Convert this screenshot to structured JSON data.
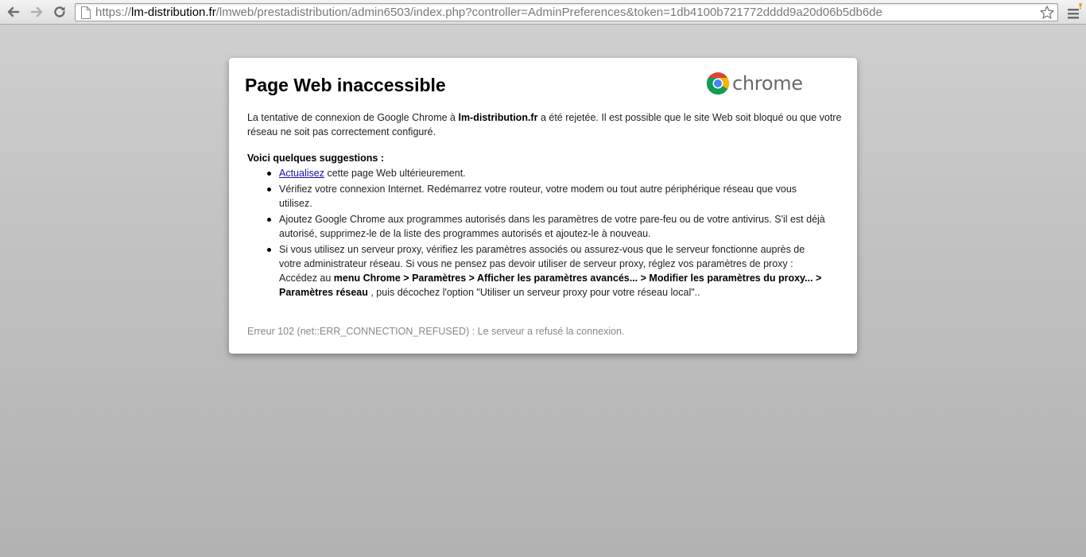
{
  "toolbar": {
    "url_scheme": "https://",
    "url_host": "lm-distribution.fr",
    "url_rest": "/lmweb/prestadistribution/admin6503/index.php?controller=AdminPreferences&token=1db4100b721772dddd9a20d06b5db6de",
    "icons": {
      "back": "back-arrow-icon",
      "forward": "forward-arrow-icon",
      "reload": "reload-icon",
      "page": "page-icon",
      "star": "star-icon",
      "menu": "menu-icon"
    }
  },
  "error": {
    "logo_text": "chrome",
    "title": "Page Web inaccessible",
    "intro_part1": "La tentative de connexion de Google Chrome à ",
    "intro_host": "lm-distribution.fr",
    "intro_part2": " a été rejetée. Il est possible que le site Web soit bloqué ou que votre réseau ne soit pas correctement configuré.",
    "suggestions_title": "Voici quelques suggestions :",
    "suggestions": [
      {
        "link": "Actualisez",
        "text": " cette page Web ultérieurement."
      },
      {
        "text": "Vérifiez votre connexion Internet. Redémarrez votre routeur, votre modem ou tout autre périphérique réseau que vous utilisez."
      },
      {
        "text": "Ajoutez Google Chrome aux programmes autorisés dans les paramètres de votre pare-feu ou de votre antivirus. S'il est déjà autorisé, supprimez-le de la liste des programmes autorisés et ajoutez-le à nouveau."
      },
      {
        "text": "Si vous utilisez un serveur proxy, vérifiez les paramètres associés ou assurez-vous que le serveur fonctionne auprès de votre administrateur réseau. Si vous ne pensez pas devoir utiliser de serveur proxy, réglez vos paramètres de proxy : Accédez au ",
        "bold": "menu Chrome > Paramètres > Afficher les paramètres avancés... > Modifier les paramètres du proxy... > Paramètres réseau",
        "text_end": " , puis décochez l'option \"Utiliser un serveur proxy pour votre réseau local\".."
      }
    ],
    "error_code": "Erreur 102 (net::ERR_CONNECTION_REFUSED) : Le serveur a refusé la connexion."
  },
  "colors": {
    "link": "#1a0dab",
    "error_code": "#888888",
    "logo_text": "#6a6a6a",
    "background": "#c4c4c4"
  }
}
